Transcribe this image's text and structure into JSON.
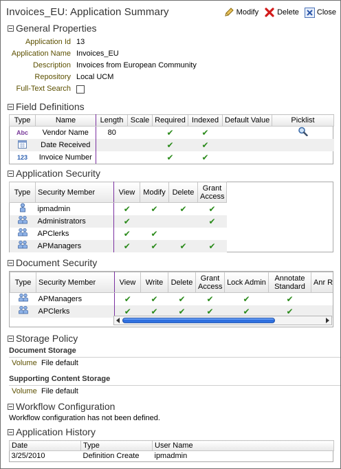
{
  "header": {
    "title": "Invoices_EU: Application Summary",
    "modify_label": "Modify",
    "delete_label": "Delete",
    "close_label": "Close"
  },
  "general": {
    "title": "General Properties",
    "fields": [
      {
        "label": "Application Id",
        "value": "13"
      },
      {
        "label": "Application Name",
        "value": "Invoices_EU"
      },
      {
        "label": "Description",
        "value": "Invoices from European Community"
      },
      {
        "label": "Repository",
        "value": "Local UCM"
      }
    ],
    "fulltext_label": "Full-Text Search",
    "fulltext_checked": false
  },
  "field_defs": {
    "title": "Field Definitions",
    "columns": [
      "Type",
      "Name",
      "Length",
      "Scale",
      "Required",
      "Indexed",
      "Default Value",
      "Picklist"
    ],
    "rows": [
      {
        "type_icon": "abc-icon",
        "type_glyph": "Abc",
        "name": "Vendor Name",
        "length": "80",
        "scale": "",
        "required": true,
        "indexed": true,
        "default": "",
        "picklist": true
      },
      {
        "type_icon": "calendar-icon",
        "type_glyph": "",
        "name": "Date Received",
        "length": "",
        "scale": "",
        "required": true,
        "indexed": true,
        "default": "",
        "picklist": false
      },
      {
        "type_icon": "number-icon",
        "type_glyph": "123",
        "name": "Invoice Number",
        "length": "",
        "scale": "",
        "required": true,
        "indexed": true,
        "default": "",
        "picklist": false
      }
    ]
  },
  "app_security": {
    "title": "Application Security",
    "columns": [
      "Type",
      "Security Member",
      "View",
      "Modify",
      "Delete",
      "Grant Access"
    ],
    "rows": [
      {
        "type_icon": "user-icon",
        "member": "ipmadmin",
        "view": true,
        "modify": true,
        "delete": true,
        "grant": true
      },
      {
        "type_icon": "group-icon",
        "member": "Administrators",
        "view": true,
        "modify": false,
        "delete": false,
        "grant": true
      },
      {
        "type_icon": "group-icon",
        "member": "APClerks",
        "view": true,
        "modify": true,
        "delete": false,
        "grant": false
      },
      {
        "type_icon": "group-icon",
        "member": "APManagers",
        "view": true,
        "modify": true,
        "delete": true,
        "grant": true
      }
    ]
  },
  "doc_security": {
    "title": "Document Security",
    "columns": [
      "Type",
      "Security Member",
      "View",
      "Write",
      "Delete",
      "Grant Access",
      "Lock Admin",
      "Annotate Standard",
      "Anr Res"
    ],
    "rows": [
      {
        "type_icon": "group-icon",
        "member": "APManagers",
        "view": true,
        "write": true,
        "delete": true,
        "grant": true,
        "lock": true,
        "annotate": true
      },
      {
        "type_icon": "group-icon",
        "member": "APClerks",
        "view": true,
        "write": true,
        "delete": true,
        "grant": true,
        "lock": true,
        "annotate": true
      }
    ]
  },
  "storage": {
    "title": "Storage Policy",
    "doc_storage_title": "Document Storage",
    "doc_volume_label": "Volume",
    "doc_volume_value": "File default",
    "support_storage_title": "Supporting Content Storage",
    "support_volume_label": "Volume",
    "support_volume_value": "File default"
  },
  "workflow": {
    "title": "Workflow Configuration",
    "message": "Workflow configuration has not been defined."
  },
  "history": {
    "title": "Application History",
    "columns": [
      "Date",
      "Type",
      "User Name"
    ],
    "rows": [
      {
        "date": "3/25/2010",
        "type": "Definition Create",
        "user": "ipmadmin"
      }
    ]
  },
  "colors": {
    "label": "#5c5000",
    "check": "#2a8a1a",
    "divider": "#7a2fa0",
    "scroll_thumb": "#1d5fd6"
  }
}
